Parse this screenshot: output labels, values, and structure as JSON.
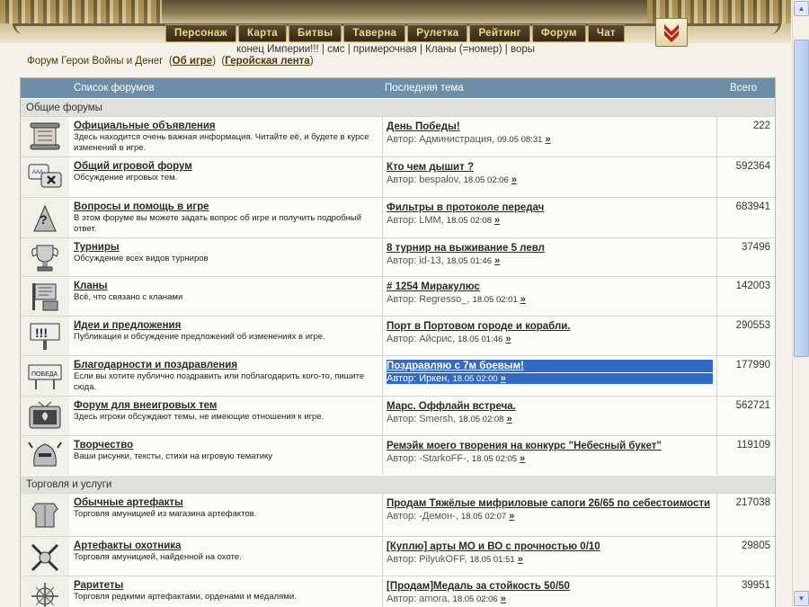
{
  "nav": {
    "items": [
      "Персонаж",
      "Карта",
      "Битвы",
      "Таверна",
      "Рулетка",
      "Рейтинг",
      "Форум",
      "Чат"
    ],
    "scroll_down_icon": "double-chevron-down-icon"
  },
  "sublinks": {
    "items": [
      "конец Империи!!!",
      "смс",
      "примерочная",
      "Кланы (=номер)",
      "воры"
    ]
  },
  "breadcrumb": {
    "title": "Форум Герои Войны и Денег",
    "about_link": "Об игре",
    "feed_link": "Геройская лента"
  },
  "table": {
    "col_forums": "Список форумов",
    "col_last": "Последняя тема",
    "col_total": "Всего",
    "author_prefix": "Автор:",
    "go_symbol": "»",
    "sections": [
      {
        "title": "Общие форумы",
        "rows": [
          {
            "name": "Официальные объявления",
            "desc": "Здесь находится очень важная информация. Читайте её, и будете в курсе изменений в игре.",
            "topic": "День Победы!",
            "author": "Администрация",
            "time": "09.05 08:31",
            "total": "222",
            "icon": "scroll-icon"
          },
          {
            "name": "Общий игровой форум",
            "desc": "Обсуждение игровых тем.",
            "topic": "Кто чем дышит ?",
            "author": "bespalov",
            "time": "18.05 02:06",
            "total": "592364",
            "icon": "chat-bubbles-icon"
          },
          {
            "name": "Вопросы и помощь в игре",
            "desc": "В этом форуме вы можете задать вопрос об игре и получить подробный ответ.",
            "topic": "Фильтры в протоколе передач",
            "author": "LMM",
            "time": "18.05 02:08",
            "total": "683941",
            "icon": "question-wizard-icon"
          },
          {
            "name": "Турниры",
            "desc": "Обсуждение всех видов турниров",
            "topic": "8 турнир на выживание 5 левл",
            "author": "id-13",
            "time": "18.05 01:46",
            "total": "37496",
            "icon": "trophy-icon"
          },
          {
            "name": "Кланы",
            "desc": "Всё, что связано с кланами",
            "topic": "# 1254 Миракулюс",
            "author": "Regresso_",
            "time": "18.05 02:01",
            "total": "142003",
            "icon": "clan-banner-icon"
          },
          {
            "name": "Идеи и предложения",
            "desc": "Публикация и обсуждение предложений об изменениях в игре.",
            "topic": "Порт в Портовом городе и корабли.",
            "author": "Айсрис",
            "time": "18.05 01:46",
            "total": "290553",
            "icon": "exclamation-sign-icon"
          },
          {
            "name": "Благодарности и поздравления",
            "desc": "Если вы хотите публично поздравить или поблагодарить кого-то, пишите сюда.",
            "topic": "Поздравляю с 7м боевым!",
            "author": "Иркен",
            "time": "18.05 02:00",
            "total": "177990",
            "icon": "victory-sign-icon",
            "selected": true
          },
          {
            "name": "Форум для внеигровых тем",
            "desc": "Здесь игроки обсуждают темы, не имеющие отношения к игре.",
            "topic": "Марс. Оффлайн встреча.",
            "author": "Smersh",
            "time": "18.05 02:08",
            "total": "562721",
            "icon": "tv-icon"
          },
          {
            "name": "Творчество",
            "desc": "Ваши рисунки, тексты, стихи на игровую тематику",
            "topic": "Ремэйк моего творения на конкурс \"Небесный букет\"",
            "author": "-StarkoFF-",
            "time": "18.05 02:05",
            "total": "119109",
            "icon": "helmet-icon"
          }
        ]
      },
      {
        "title": "Торговля и услуги",
        "rows": [
          {
            "name": "Обычные артефакты",
            "desc": "Торговля амуницией из магазина артефактов.",
            "topic": "Продам Тяжёлые мифриловые сапоги 26/65 по себестоимости",
            "author": "-Демон-",
            "time": "18.05 02:07",
            "total": "217038",
            "icon": "armor-icon"
          },
          {
            "name": "Артефакты охотника",
            "desc": "Торговля амуницией, найденной на охоте.",
            "topic": "[Куплю] арты МО и ВО с прочностью 0/10",
            "author": "PilyukOFF",
            "time": "18.05 01:51",
            "total": "29805",
            "icon": "crossed-weapons-icon"
          },
          {
            "name": "Раритеты",
            "desc": "Торговля редкими артефактами, орденами и медалями.",
            "topic": "[Продам]Медаль за стойкость 50/50",
            "author": "amora",
            "time": "18.05 02:06",
            "total": "39951",
            "icon": "rare-artifact-icon"
          }
        ]
      }
    ]
  }
}
